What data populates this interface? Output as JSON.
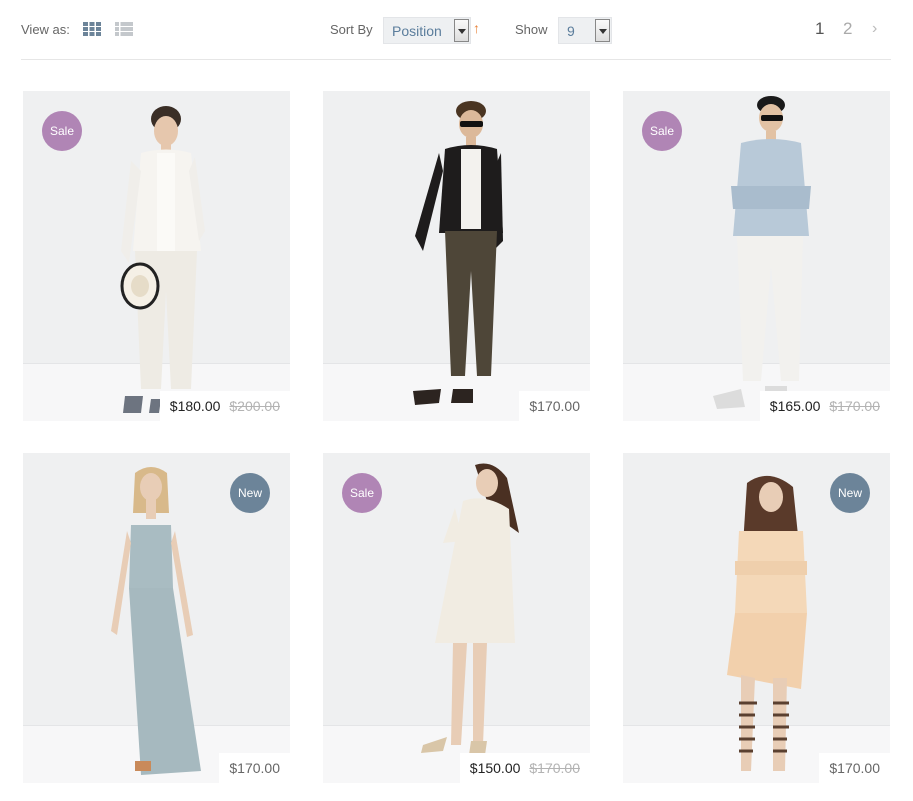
{
  "toolbar": {
    "view_as_label": "View as:",
    "sort_by_label": "Sort By",
    "sort_value": "Position",
    "show_label": "Show",
    "show_value": "9",
    "pages": [
      "1",
      "2"
    ]
  },
  "products": [
    {
      "badge": "Sale",
      "price": "$180.00",
      "old_price": "$200.00"
    },
    {
      "badge": "",
      "price": "$170.00",
      "old_price": ""
    },
    {
      "badge": "Sale",
      "price": "$165.00",
      "old_price": "$170.00"
    },
    {
      "badge": "New",
      "price": "$170.00",
      "old_price": ""
    },
    {
      "badge": "Sale",
      "price": "$150.00",
      "old_price": "$170.00"
    },
    {
      "badge": "New",
      "price": "$170.00",
      "old_price": ""
    }
  ],
  "colors": {
    "sale_badge": "#b085b5",
    "new_badge": "#6c8499",
    "sort_arrow": "#e8823a"
  }
}
